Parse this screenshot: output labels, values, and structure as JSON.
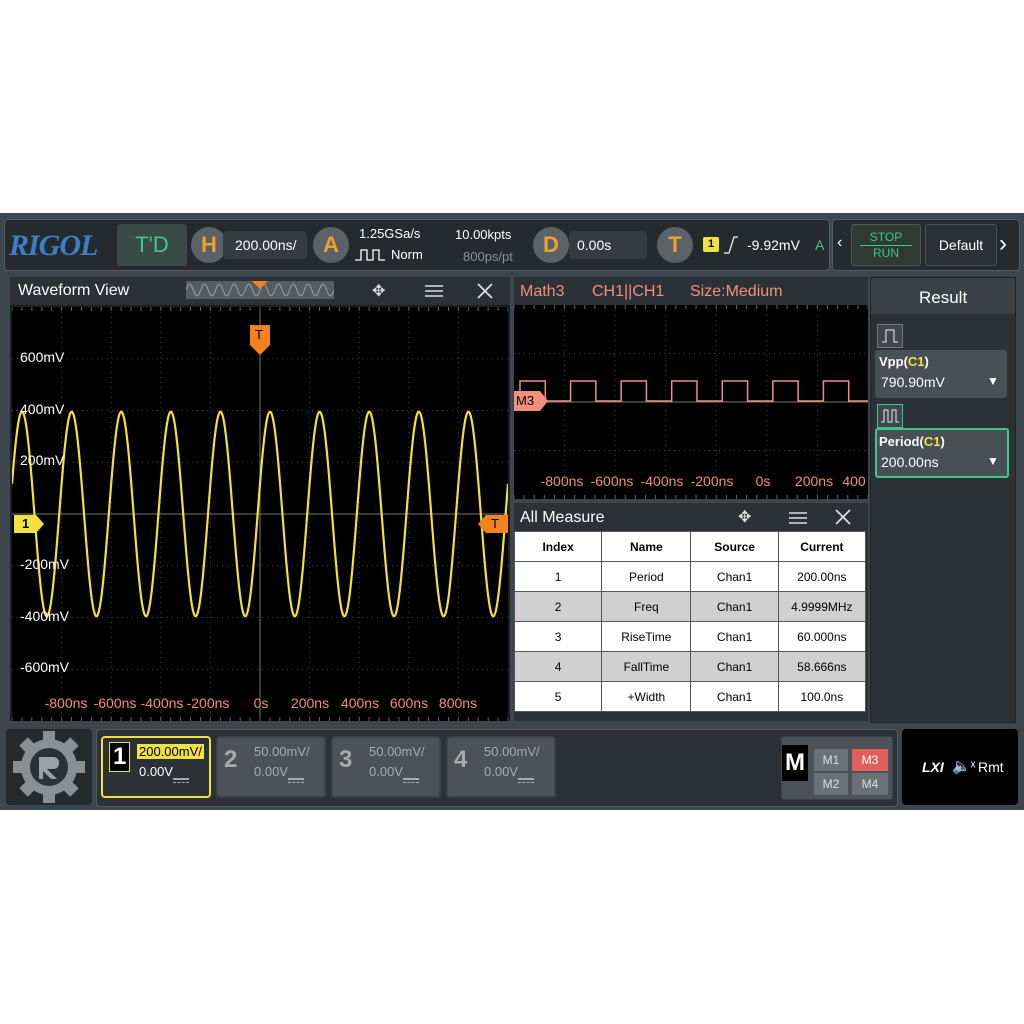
{
  "header": {
    "brand": "RIGOL",
    "td_label": "T'D",
    "horizontal": {
      "icon": "H",
      "scale": "200.00ns/"
    },
    "acquire": {
      "icon": "A",
      "sample_rate": "1.25GSa/s",
      "memory": "10.00kpts",
      "mode": "Norm",
      "resolution": "800ps/pt"
    },
    "delay": {
      "icon": "D",
      "value": "0.00s"
    },
    "trigger": {
      "icon": "T",
      "source": "1",
      "level": "-9.92mV",
      "mode": "A"
    },
    "stop_label": "STOP",
    "run_label": "RUN",
    "default_label": "Default"
  },
  "waveform_view": {
    "title": "Waveform View",
    "y_labels": [
      "600mV",
      "400mV",
      "200mV",
      "-200mV",
      "-400mV",
      "-600mV"
    ],
    "x_labels": [
      "-800ns",
      "-600ns",
      "-400ns",
      "-200ns",
      "0s",
      "200ns",
      "400ns",
      "600ns",
      "800ns"
    ],
    "channel_marker": "1",
    "trigger_marker": "T"
  },
  "math_view": {
    "title_source": "Math3",
    "title_op": "CH1||CH1",
    "title_size": "Size:Medium",
    "marker": "M3",
    "x_labels": [
      "-800ns",
      "-600ns",
      "-400ns",
      "-200ns",
      "0s",
      "200ns",
      "400"
    ]
  },
  "all_measure": {
    "title": "All Measure",
    "columns": [
      "Index",
      "Name",
      "Source",
      "Current"
    ],
    "rows": [
      [
        "1",
        "Period",
        "Chan1",
        "200.00ns"
      ],
      [
        "2",
        "Freq",
        "Chan1",
        "4.9999MHz"
      ],
      [
        "3",
        "RiseTime",
        "Chan1",
        "60.000ns"
      ],
      [
        "4",
        "FallTime",
        "Chan1",
        "58.666ns"
      ],
      [
        "5",
        "+Width",
        "Chan1",
        "100.0ns"
      ]
    ]
  },
  "result": {
    "title": "Result",
    "items": [
      {
        "name": "Vpp",
        "source": "C1",
        "value": "790.90mV"
      },
      {
        "name": "Period",
        "source": "C1",
        "value": "200.00ns"
      }
    ]
  },
  "channels": [
    {
      "num": "1",
      "scale": "200.00mV/",
      "offset": "0.00V",
      "active": true
    },
    {
      "num": "2",
      "scale": "50.00mV/",
      "offset": "0.00V",
      "active": false
    },
    {
      "num": "3",
      "scale": "50.00mV/",
      "offset": "0.00V",
      "active": false
    },
    {
      "num": "4",
      "scale": "50.00mV/",
      "offset": "0.00V",
      "active": false
    }
  ],
  "math": {
    "label": "M",
    "slots": [
      "M1",
      "M3",
      "M2",
      "M4"
    ]
  },
  "status": {
    "lxi": "LXI",
    "rmt": "Rmt"
  },
  "waveform": {
    "cycles_per_screen": 10,
    "amplitude_v": 0.3955
  },
  "colors": {
    "ch1": "#f0e040",
    "math": "#f0907c",
    "trigger": "#f58220",
    "accent_green": "#3ec98a"
  },
  "icons": [
    "rigol-logo",
    "trigger-rising-edge-icon",
    "move-icon",
    "menu-icon",
    "close-icon",
    "speaker-mute-icon",
    "pulse-icon",
    "gear-logo"
  ]
}
